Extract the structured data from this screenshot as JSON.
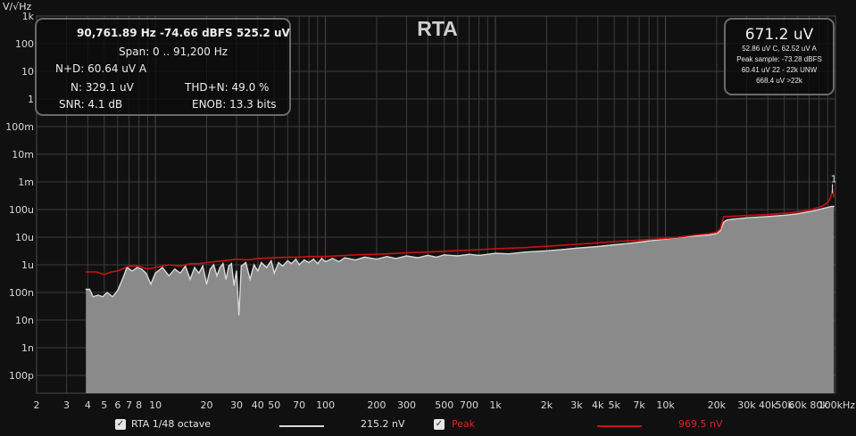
{
  "title": "RTA",
  "y_unit": "V/√Hz",
  "info_panel": {
    "header": "90,761.89 Hz  -74.66 dBFS  525.2 uV",
    "span": "Span: 0 .. 91,200 Hz",
    "nd": "N+D: 60.64 uV A",
    "n": "N:  329.1 uV",
    "thdn": "THD+N:  49.0 %",
    "snr": "SNR:  4.1 dB",
    "enob": "ENOB:  13.3 bits"
  },
  "level_panel": {
    "main": "671.2 uV",
    "lines": [
      "52.86 uV C, 62.52 uV A",
      "Peak sample: -73.28 dBFS",
      "60.41 uV 22 - 22k UNW",
      "668.4 uV >22k"
    ]
  },
  "marker_label": "1",
  "legend": {
    "rta_checked": "✓",
    "rta_label": "RTA 1/48 octave",
    "rta_value": "215.2 nV",
    "peak_checked": "✓",
    "peak_label": "Peak",
    "peak_value": "969.5 nV"
  },
  "colors": {
    "background": "#101010",
    "fill": "#8a8a8a",
    "rta_line": "#d8d8d8",
    "peak_line": "#cc1111",
    "peak_text": "#e02020",
    "grid": "#3c3c3c"
  },
  "chart_data": {
    "type": "area",
    "x_scale": "log",
    "y_scale": "log",
    "xlim": [
      2,
      100000
    ],
    "ylim": [
      1e-16,
      1000
    ],
    "grid": true,
    "x_ticks": [
      {
        "v": 2,
        "label": "2"
      },
      {
        "v": 3,
        "label": "3"
      },
      {
        "v": 4,
        "label": "4"
      },
      {
        "v": 5,
        "label": "5"
      },
      {
        "v": 6,
        "label": "6"
      },
      {
        "v": 7,
        "label": "7"
      },
      {
        "v": 8,
        "label": "8"
      },
      {
        "v": 10,
        "label": "10"
      },
      {
        "v": 20,
        "label": "20"
      },
      {
        "v": 30,
        "label": "30"
      },
      {
        "v": 40,
        "label": "40"
      },
      {
        "v": 50,
        "label": "50"
      },
      {
        "v": 70,
        "label": "70"
      },
      {
        "v": 100,
        "label": "100"
      },
      {
        "v": 200,
        "label": "200"
      },
      {
        "v": 300,
        "label": "300"
      },
      {
        "v": 500,
        "label": "500"
      },
      {
        "v": 700,
        "label": "700"
      },
      {
        "v": 1000,
        "label": "1k"
      },
      {
        "v": 2000,
        "label": "2k"
      },
      {
        "v": 3000,
        "label": "3k"
      },
      {
        "v": 4000,
        "label": "4k"
      },
      {
        "v": 5000,
        "label": "5k"
      },
      {
        "v": 7000,
        "label": "7k"
      },
      {
        "v": 10000,
        "label": "10k"
      },
      {
        "v": 20000,
        "label": "20k"
      },
      {
        "v": 30000,
        "label": "30k"
      },
      {
        "v": 40000,
        "label": "40k"
      },
      {
        "v": 50000,
        "label": "50k"
      },
      {
        "v": 60000,
        "label": "60k"
      },
      {
        "v": 80000,
        "label": "80k"
      },
      {
        "v": 100000,
        "label": "100kHz"
      }
    ],
    "y_ticks": [
      {
        "v": 1000,
        "label": "1k"
      },
      {
        "v": 100,
        "label": "100"
      },
      {
        "v": 10,
        "label": "10"
      },
      {
        "v": 1,
        "label": "1"
      },
      {
        "v": 0.1,
        "label": "100m"
      },
      {
        "v": 0.01,
        "label": "10m"
      },
      {
        "v": 0.001,
        "label": "1m"
      },
      {
        "v": 0.0001,
        "label": "100u"
      },
      {
        "v": 1e-05,
        "label": "10u"
      },
      {
        "v": 1e-06,
        "label": "1u"
      },
      {
        "v": 1e-07,
        "label": "100n"
      },
      {
        "v": 1e-08,
        "label": "10n"
      },
      {
        "v": 1e-09,
        "label": "1n"
      },
      {
        "v": 1e-10,
        "label": "100p"
      }
    ],
    "series": [
      {
        "name": "RTA 1/48 octave",
        "points": [
          [
            3.9,
            1.3e-07
          ],
          [
            4.1,
            1.3e-07
          ],
          [
            4.3,
            7e-08
          ],
          [
            4.6,
            8e-08
          ],
          [
            4.9,
            7e-08
          ],
          [
            5.2,
            1e-07
          ],
          [
            5.6,
            7e-08
          ],
          [
            6.0,
            1.2e-07
          ],
          [
            6.4,
            3e-07
          ],
          [
            6.8,
            8e-07
          ],
          [
            7.3,
            6e-07
          ],
          [
            7.8,
            8e-07
          ],
          [
            8.3,
            7e-07
          ],
          [
            8.8,
            5e-07
          ],
          [
            9.4,
            2e-07
          ],
          [
            10,
            5e-07
          ],
          [
            11,
            8e-07
          ],
          [
            12,
            4e-07
          ],
          [
            13,
            7e-07
          ],
          [
            14,
            5e-07
          ],
          [
            15,
            9e-07
          ],
          [
            16,
            3e-07
          ],
          [
            17,
            8e-07
          ],
          [
            18,
            5e-07
          ],
          [
            19,
            9e-07
          ],
          [
            20,
            2e-07
          ],
          [
            21,
            7e-07
          ],
          [
            22,
            1e-06
          ],
          [
            23,
            4e-07
          ],
          [
            24,
            8e-07
          ],
          [
            25,
            1.1e-06
          ],
          [
            26,
            3e-07
          ],
          [
            27,
            9e-07
          ],
          [
            28,
            1.1e-06
          ],
          [
            29,
            1.8e-07
          ],
          [
            30,
            6e-07
          ],
          [
            31,
            1.5e-08
          ],
          [
            32,
            9e-07
          ],
          [
            34,
            1.2e-06
          ],
          [
            36,
            3e-07
          ],
          [
            38,
            1e-06
          ],
          [
            40,
            6e-07
          ],
          [
            42,
            1.2e-06
          ],
          [
            45,
            8e-07
          ],
          [
            48,
            1.4e-06
          ],
          [
            50,
            5e-07
          ],
          [
            53,
            1.2e-06
          ],
          [
            56,
            9e-07
          ],
          [
            60,
            1.4e-06
          ],
          [
            63,
            1.1e-06
          ],
          [
            67,
            1.6e-06
          ],
          [
            70,
            1e-06
          ],
          [
            75,
            1.5e-06
          ],
          [
            80,
            1.2e-06
          ],
          [
            85,
            1.6e-06
          ],
          [
            90,
            1.1e-06
          ],
          [
            95,
            1.7e-06
          ],
          [
            100,
            1.3e-06
          ],
          [
            110,
            1.7e-06
          ],
          [
            120,
            1.3e-06
          ],
          [
            130,
            1.8e-06
          ],
          [
            150,
            1.5e-06
          ],
          [
            170,
            1.9e-06
          ],
          [
            200,
            1.6e-06
          ],
          [
            230,
            2e-06
          ],
          [
            260,
            1.7e-06
          ],
          [
            300,
            2.1e-06
          ],
          [
            350,
            1.8e-06
          ],
          [
            400,
            2.2e-06
          ],
          [
            450,
            1.9e-06
          ],
          [
            500,
            2.3e-06
          ],
          [
            600,
            2.1e-06
          ],
          [
            700,
            2.4e-06
          ],
          [
            800,
            2.2e-06
          ],
          [
            1000,
            2.6e-06
          ],
          [
            1200,
            2.5e-06
          ],
          [
            1500,
            2.9e-06
          ],
          [
            2000,
            3.2e-06
          ],
          [
            2500,
            3.6e-06
          ],
          [
            3000,
            4e-06
          ],
          [
            4000,
            4.6e-06
          ],
          [
            5000,
            5.3e-06
          ],
          [
            6000,
            5.9e-06
          ],
          [
            7000,
            6.6e-06
          ],
          [
            8000,
            7.3e-06
          ],
          [
            10000,
            8.5e-06
          ],
          [
            12000,
            9.8e-06
          ],
          [
            15000,
            1.1e-05
          ],
          [
            18000,
            1.2e-05
          ],
          [
            20000,
            1.35e-05
          ],
          [
            21000,
            1.7e-05
          ],
          [
            22000,
            3.5e-05
          ],
          [
            23000,
            4.2e-05
          ],
          [
            25000,
            4.5e-05
          ],
          [
            30000,
            5e-05
          ],
          [
            40000,
            5.6e-05
          ],
          [
            50000,
            6.2e-05
          ],
          [
            60000,
            7e-05
          ],
          [
            70000,
            8.3e-05
          ],
          [
            80000,
            0.0001
          ],
          [
            85000,
            0.00011
          ],
          [
            90000,
            0.00012
          ],
          [
            95000,
            0.00013
          ],
          [
            98000,
            0.00013
          ]
        ]
      },
      {
        "name": "Peak",
        "points": [
          [
            3.9,
            5.5e-07
          ],
          [
            4.5,
            5.5e-07
          ],
          [
            5,
            4.5e-07
          ],
          [
            5.5,
            5.5e-07
          ],
          [
            6,
            6e-07
          ],
          [
            7,
            9e-07
          ],
          [
            8,
            9e-07
          ],
          [
            9,
            7e-07
          ],
          [
            10,
            8e-07
          ],
          [
            12,
            1e-06
          ],
          [
            14,
            9e-07
          ],
          [
            16,
            1.1e-06
          ],
          [
            18,
            1.1e-06
          ],
          [
            20,
            1.2e-06
          ],
          [
            25,
            1.4e-06
          ],
          [
            30,
            1.6e-06
          ],
          [
            35,
            1.5e-06
          ],
          [
            40,
            1.7e-06
          ],
          [
            50,
            1.8e-06
          ],
          [
            60,
            1.9e-06
          ],
          [
            70,
            1.9e-06
          ],
          [
            80,
            2e-06
          ],
          [
            100,
            2e-06
          ],
          [
            150,
            2.3e-06
          ],
          [
            200,
            2.4e-06
          ],
          [
            300,
            2.7e-06
          ],
          [
            400,
            2.9e-06
          ],
          [
            500,
            3.1e-06
          ],
          [
            700,
            3.4e-06
          ],
          [
            1000,
            3.8e-06
          ],
          [
            1500,
            4.2e-06
          ],
          [
            2000,
            4.7e-06
          ],
          [
            3000,
            5.5e-06
          ],
          [
            4000,
            6.2e-06
          ],
          [
            5000,
            6.9e-06
          ],
          [
            7000,
            7.8e-06
          ],
          [
            10000,
            9e-06
          ],
          [
            12000,
            1e-05
          ],
          [
            15000,
            1.2e-05
          ],
          [
            18000,
            1.35e-05
          ],
          [
            20000,
            1.5e-05
          ],
          [
            21000,
            2e-05
          ],
          [
            22000,
            5.5e-05
          ],
          [
            25000,
            5.7e-05
          ],
          [
            30000,
            6.1e-05
          ],
          [
            40000,
            6.6e-05
          ],
          [
            50000,
            7.3e-05
          ],
          [
            60000,
            8.1e-05
          ],
          [
            70000,
            9.5e-05
          ],
          [
            80000,
            0.00012
          ],
          [
            85000,
            0.00014
          ],
          [
            90000,
            0.00018
          ],
          [
            92000,
            0.00022
          ],
          [
            94000,
            0.0003
          ],
          [
            96000,
            0.00053
          ],
          [
            98000,
            0.00028
          ]
        ]
      }
    ]
  }
}
